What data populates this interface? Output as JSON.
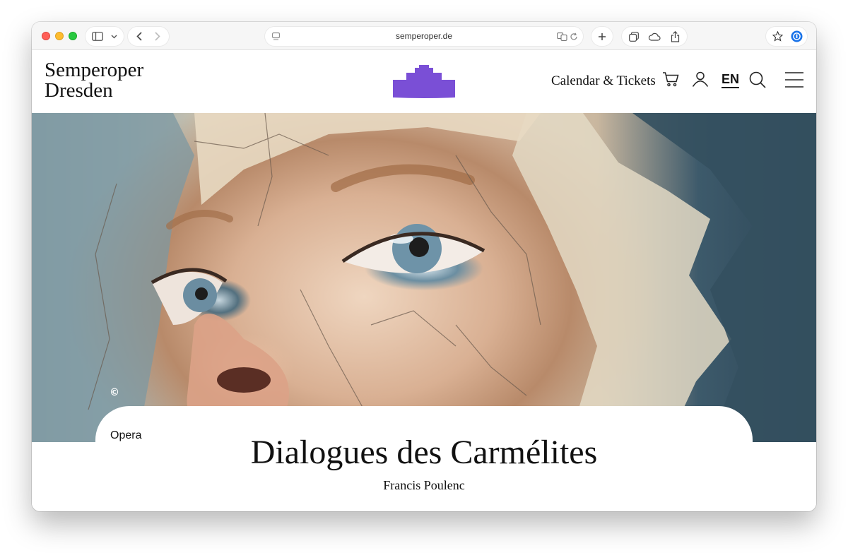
{
  "browser": {
    "url": "semperoper.de"
  },
  "site": {
    "logo_line1": "Semperoper",
    "logo_line2": "Dresden",
    "nav_calendar": "Calendar & Tickets",
    "language": "EN",
    "brand_color": "#7a4fd6"
  },
  "hero": {
    "copyright_symbol": "©"
  },
  "production": {
    "category": "Opera",
    "title": "Dialogues des Carmélites",
    "composer": "Francis Poulenc"
  }
}
